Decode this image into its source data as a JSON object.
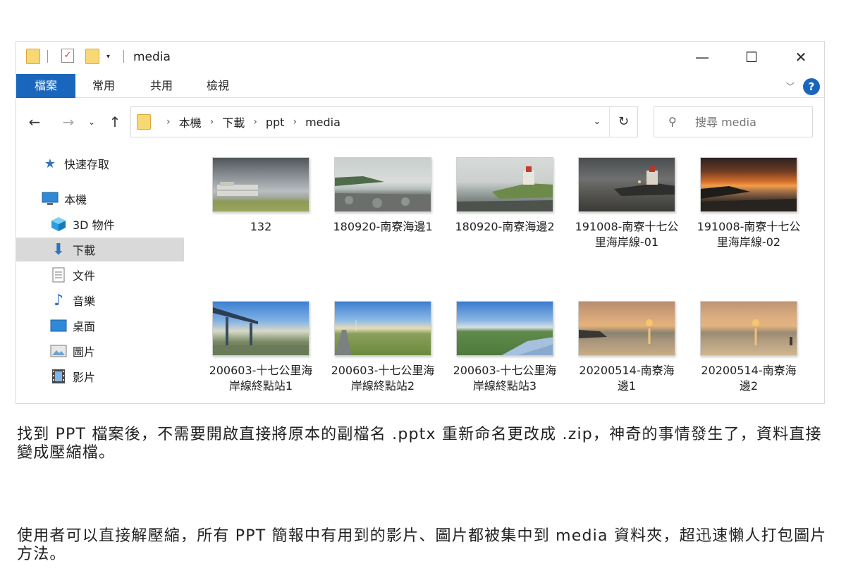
{
  "window": {
    "title": "media",
    "minimize_glyph": "—",
    "maximize_glyph": "☐",
    "close_glyph": "✕"
  },
  "ribbon": {
    "tabs": [
      "檔案",
      "常用",
      "共用",
      "檢視"
    ],
    "help_glyph": "?"
  },
  "address": {
    "crumbs": [
      "本機",
      "下載",
      "ppt",
      "media"
    ],
    "refresh_glyph": "↻"
  },
  "search": {
    "placeholder": "搜尋 media"
  },
  "nav_pane": {
    "items": [
      {
        "label": "快速存取",
        "icon": "star-icon"
      },
      {
        "label": "本機",
        "icon": "computer-icon"
      },
      {
        "label": "3D 物件",
        "icon": "cube-icon"
      },
      {
        "label": "下載",
        "icon": "download-icon",
        "selected": true
      },
      {
        "label": "文件",
        "icon": "document-icon"
      },
      {
        "label": "音樂",
        "icon": "music-icon"
      },
      {
        "label": "桌面",
        "icon": "desktop-icon"
      },
      {
        "label": "圖片",
        "icon": "pictures-icon"
      },
      {
        "label": "影片",
        "icon": "videos-icon"
      }
    ]
  },
  "files": [
    {
      "name": "132",
      "thumb": "cloudy-sky-building"
    },
    {
      "name": "180920-南寮海邊1",
      "thumb": "seashore-rocks"
    },
    {
      "name": "180920-南寮海邊2",
      "thumb": "lighthouse-shore"
    },
    {
      "name": "191008-南寮十七公里海岸線-01",
      "thumb": "lighthouse-dusk"
    },
    {
      "name": "191008-南寮十七公里海岸線-02",
      "thumb": "orange-sunset"
    },
    {
      "name": "200603-十七公里海岸線終點站1",
      "thumb": "shelter-blue-sky"
    },
    {
      "name": "200603-十七公里海岸線終點站2",
      "thumb": "path-grass-sky"
    },
    {
      "name": "200603-十七公里海岸線終點站3",
      "thumb": "river-green-bank"
    },
    {
      "name": "20200514-南寮海邊1",
      "thumb": "sunset-beach"
    },
    {
      "name": "20200514-南寮海邊2",
      "thumb": "sunset-beach-people"
    }
  ],
  "article": {
    "paragraph1": "找到 PPT 檔案後，不需要開啟直接將原本的副檔名 .pptx 重新命名更改成 .zip，神奇的事情發生了，資料直接變成壓縮檔。",
    "paragraph2": "使用者可以直接解壓縮，所有 PPT 簡報中有用到的影片、圖片都被集中到 media 資料夾，超迅速懶人打包圖片方法。"
  }
}
